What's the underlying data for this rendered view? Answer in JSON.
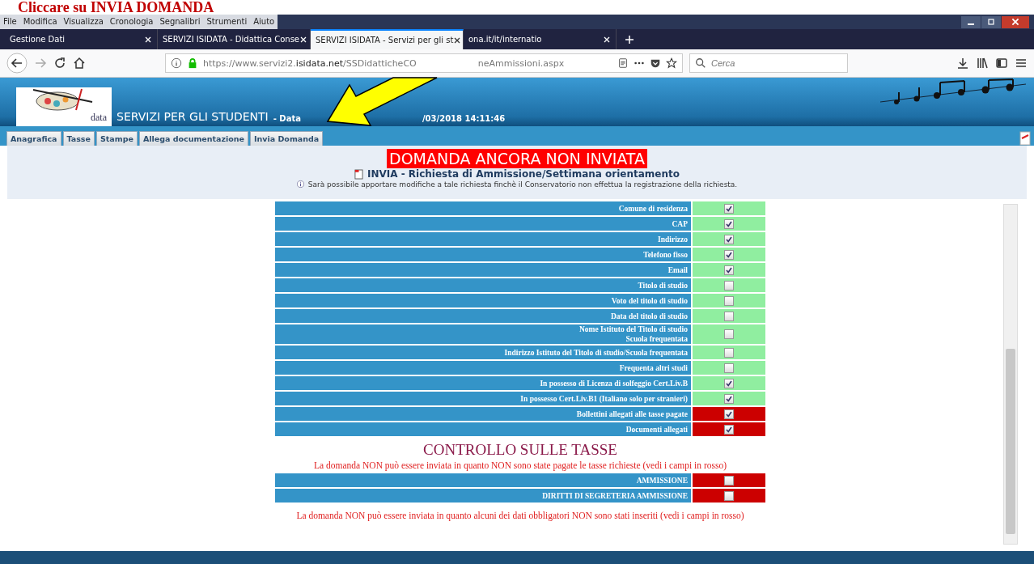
{
  "annotation": {
    "caption": "Cliccare su INVIA DOMANDA"
  },
  "menu_bar": [
    "File",
    "Modifica",
    "Visualizza",
    "Cronologia",
    "Segnalibri",
    "Strumenti",
    "Aiuto"
  ],
  "browser_tabs": [
    {
      "title": "Gestione Dati",
      "selected": false
    },
    {
      "title": "SERVIZI ISIDATA - Didattica Conse",
      "selected": false
    },
    {
      "title": "SERVIZI ISIDATA - Servizi per gli st",
      "selected": true
    },
    {
      "title": "ona.it/it/internatio",
      "selected": false
    }
  ],
  "address_bar": {
    "url_start": "https://www.servizi2.",
    "url_domain": "isidata.net",
    "url_path": "/SSDidatticheCO",
    "url_end": "neAmmissioni.aspx"
  },
  "search": {
    "placeholder": "Cerca"
  },
  "header": {
    "logo_text": "data",
    "title": "SERVIZI PER GLI STUDENTI",
    "date_label": "- Data",
    "date_value": "/03/2018 14:11:46"
  },
  "tabs": [
    "Anagrafica",
    "Tasse",
    "Stampe",
    "Allega documentazione",
    "Invia Domanda"
  ],
  "status_banner": "DOMANDA ANCORA NON INVIATA",
  "request_title": "INVIA - Richiesta di Ammissione/Settimana orientamento",
  "request_note": "Sarà possibile apportare modifiche a tale richiesta finchè il Conservatorio non effettua la registrazione della richiesta.",
  "checklist": [
    {
      "label": "Comune di residenza",
      "checked": true,
      "color": "#90eea0"
    },
    {
      "label": "CAP",
      "checked": true,
      "color": "#90eea0"
    },
    {
      "label": "Indirizzo",
      "checked": true,
      "color": "#90eea0"
    },
    {
      "label": "Telefono fisso",
      "checked": true,
      "color": "#90eea0"
    },
    {
      "label": "Email",
      "checked": true,
      "color": "#90eea0"
    },
    {
      "label": "Titolo di studio",
      "checked": false,
      "color": "#90eea0"
    },
    {
      "label": "Voto del titolo di studio",
      "checked": false,
      "color": "#90eea0"
    },
    {
      "label": "Data del titolo di studio",
      "checked": false,
      "color": "#90eea0"
    },
    {
      "label": "Nome Istituto del Titolo di studio\nScuola frequentata",
      "checked": false,
      "color": "#90eea0"
    },
    {
      "label": "Indirizzo Istituto del Titolo di studio/Scuola frequentata",
      "checked": false,
      "color": "#90eea0"
    },
    {
      "label": "Frequenta altri studi",
      "checked": false,
      "color": "#90eea0"
    },
    {
      "label": "In possesso di Licenza di solfeggio Cert.Liv.B",
      "checked": true,
      "color": "#90eea0"
    },
    {
      "label": "In possesso Cert.Liv.B1 (Italiano solo per stranieri)",
      "checked": true,
      "color": "#90eea0"
    },
    {
      "label": "Bollettini allegati alle tasse pagate",
      "checked": true,
      "color": "#cc0000"
    },
    {
      "label": "Documenti allegati",
      "checked": true,
      "color": "#cc0000"
    }
  ],
  "fees": {
    "title": "CONTROLLO SULLE TASSE",
    "message": "La domanda NON può essere inviata in quanto NON sono state pagate le tasse richieste (vedi i campi in rosso)",
    "rows": [
      {
        "label": "AMMISSIONE",
        "checked": false,
        "color": "#cc0000"
      },
      {
        "label": "DIRITTI DI SEGRETERIA AMMISSIONE",
        "checked": false,
        "color": "#cc0000"
      }
    ]
  },
  "final_message": "La domanda NON può essere inviata in quanto alcuni dei dati obbligatori NON sono stati inseriti (vedi i campi in rosso)"
}
